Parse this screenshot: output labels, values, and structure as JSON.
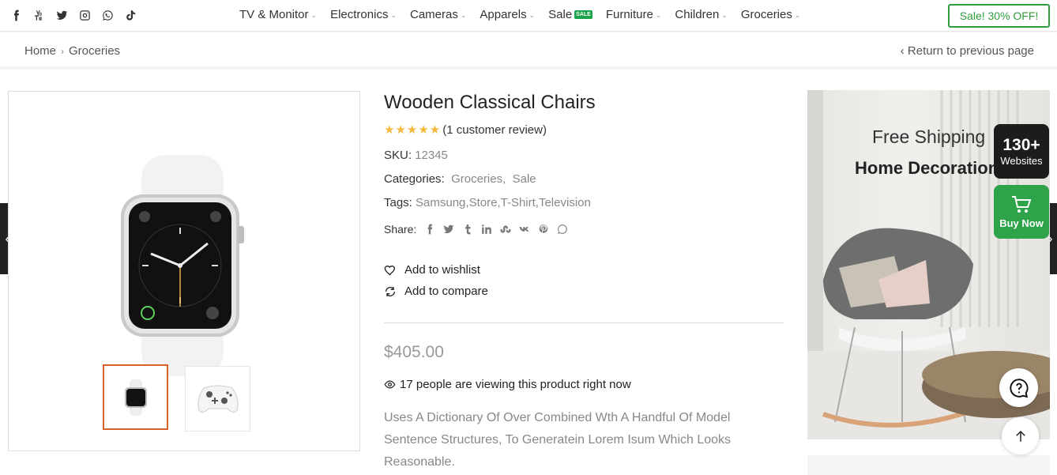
{
  "social_icons": [
    "facebook-icon",
    "youtube-icon",
    "twitter-icon",
    "instagram-icon",
    "whatsapp-icon",
    "tiktok-icon"
  ],
  "nav": {
    "items": [
      {
        "label": "TV & Monitor"
      },
      {
        "label": "Electronics"
      },
      {
        "label": "Cameras"
      },
      {
        "label": "Apparels"
      },
      {
        "label": "Sale",
        "badge": "SALE"
      },
      {
        "label": "Furniture"
      },
      {
        "label": "Children"
      },
      {
        "label": "Groceries"
      }
    ]
  },
  "promo": {
    "label": "Sale! 30% OFF!",
    "color": "#2e9d3c"
  },
  "breadcrumb": {
    "home": "Home",
    "current": "Groceries",
    "return_label": "Return to previous page"
  },
  "product": {
    "title": "Wooden Classical Chairs",
    "rating": 5,
    "review_text": "(1 customer review)",
    "sku_label": "SKU:",
    "sku": "12345",
    "categories_label": "Categories:",
    "categories": [
      "Groceries",
      "Sale"
    ],
    "tags_label": "Tags:",
    "tags": [
      "Samsung",
      "Store",
      "T-Shirt",
      "Television"
    ],
    "share_label": "Share:",
    "share_icons": [
      "facebook-icon",
      "twitter-icon",
      "tumblr-icon",
      "linkedin-icon",
      "stumbleupon-icon",
      "vk-icon",
      "pinterest-icon",
      "whatsapp-icon"
    ],
    "wishlist_label": "Add to wishlist",
    "compare_label": "Add to compare",
    "price": "$405.00",
    "viewing": "17 people are viewing this product right now",
    "description": "Uses A Dictionary Of Over Combined Wth A Handful Of Model Sentence Structures, To Generatein Lorem Isum Which Looks Reasonable."
  },
  "banner": {
    "line1": "Free Shipping",
    "line2": "Home Decoration"
  },
  "floating": {
    "websites_count": "130+",
    "websites_label": "Websites",
    "buy_label": "Buy Now",
    "buy_color": "#2ea34a"
  },
  "colors": {
    "accent": "#d9622b",
    "star": "#f5b83b"
  }
}
